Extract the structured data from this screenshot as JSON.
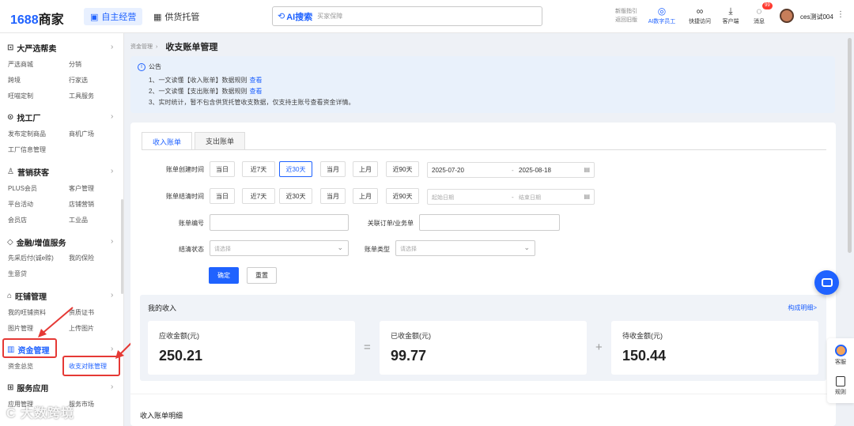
{
  "topbar": {
    "logo_num": "1688",
    "logo_text": "商家",
    "nav_self": "自主经营",
    "nav_supply": "供货托管",
    "search_ai": "AI搜索",
    "search_placeholder": "买家保障",
    "guide_line1": "新版指引",
    "guide_line2": "返回旧版",
    "ai_staff": "AI数字员工",
    "quick_access": "快捷访问",
    "client_download": "客户端",
    "messages": "消息",
    "msg_badge": "99",
    "username": "ces测试004"
  },
  "sidebar": {
    "sections": [
      {
        "title": "大严选帮卖",
        "items": [
          "严选商城",
          "分销",
          "跨境",
          "行家选",
          "旺喵定制",
          "工具服务"
        ]
      },
      {
        "title": "找工厂",
        "items": [
          "发布定制商品",
          "商机广场",
          "工厂信息管理"
        ]
      },
      {
        "title": "营销获客",
        "items": [
          "PLUS会员",
          "客户管理",
          "平台活动",
          "店铺营销",
          "会员店",
          "工业品"
        ]
      },
      {
        "title": "金融/增值服务",
        "items": [
          "先采后付(诚e赊)",
          "我的保险",
          "生意贷"
        ]
      },
      {
        "title": "旺铺管理",
        "items": [
          "我的旺铺资料",
          "资质证书",
          "图片管理",
          "上传图片"
        ]
      },
      {
        "title": "资金管理",
        "items": [
          "资金总览",
          "收支对账管理"
        ]
      },
      {
        "title": "服务应用",
        "items": [
          "应用管理",
          "服务市场"
        ]
      }
    ]
  },
  "watermark": "大数跨境",
  "breadcrumb": {
    "parent": "资金管理",
    "current": "收支账单管理"
  },
  "notice": {
    "title": "公告",
    "lines": [
      {
        "text": "1、一文读懂【收入账单】数据规则",
        "link": "查看"
      },
      {
        "text": "2、一文读懂【支出账单】数据规则",
        "link": "查看"
      },
      {
        "text": "3、实时统计，暂不包含供货托管收支数据，仅支持主账号查看资金详情。",
        "link": ""
      }
    ]
  },
  "tabs": {
    "income": "收入账单",
    "expense": "支出账单"
  },
  "filters": {
    "create_time_label": "账单创建时间",
    "settle_time_label": "账单结清时间",
    "quick_ranges": [
      "当日",
      "近7天",
      "近30天",
      "当月",
      "上月",
      "近90天"
    ],
    "create_start": "2025-07-20",
    "create_end": "2025-08-18",
    "settle_start_placeholder": "起始日期",
    "settle_end_placeholder": "结束日期",
    "bill_no_label": "账单编号",
    "related_order_label": "关联订单/业务单",
    "settle_status_label": "结清状态",
    "settle_status_placeholder": "请选择",
    "bill_type_label": "账单类型",
    "bill_type_placeholder": "请选择",
    "confirm": "确定",
    "reset": "重置",
    "range_sep": "-"
  },
  "income": {
    "title": "我的收入",
    "breakdown_link": "构成明细>",
    "receivable_label": "应收金额(元)",
    "receivable_value": "250.21",
    "received_label": "已收金额(元)",
    "received_value": "99.77",
    "pending_label": "待收金额(元)",
    "pending_value": "150.44",
    "op_eq": "=",
    "op_plus": "+"
  },
  "detail_title": "收入账单明细",
  "right_panel": {
    "service": "客服",
    "rules": "规则"
  },
  "colors": {
    "accent": "#1f62ff",
    "highlight": "#e53935"
  }
}
